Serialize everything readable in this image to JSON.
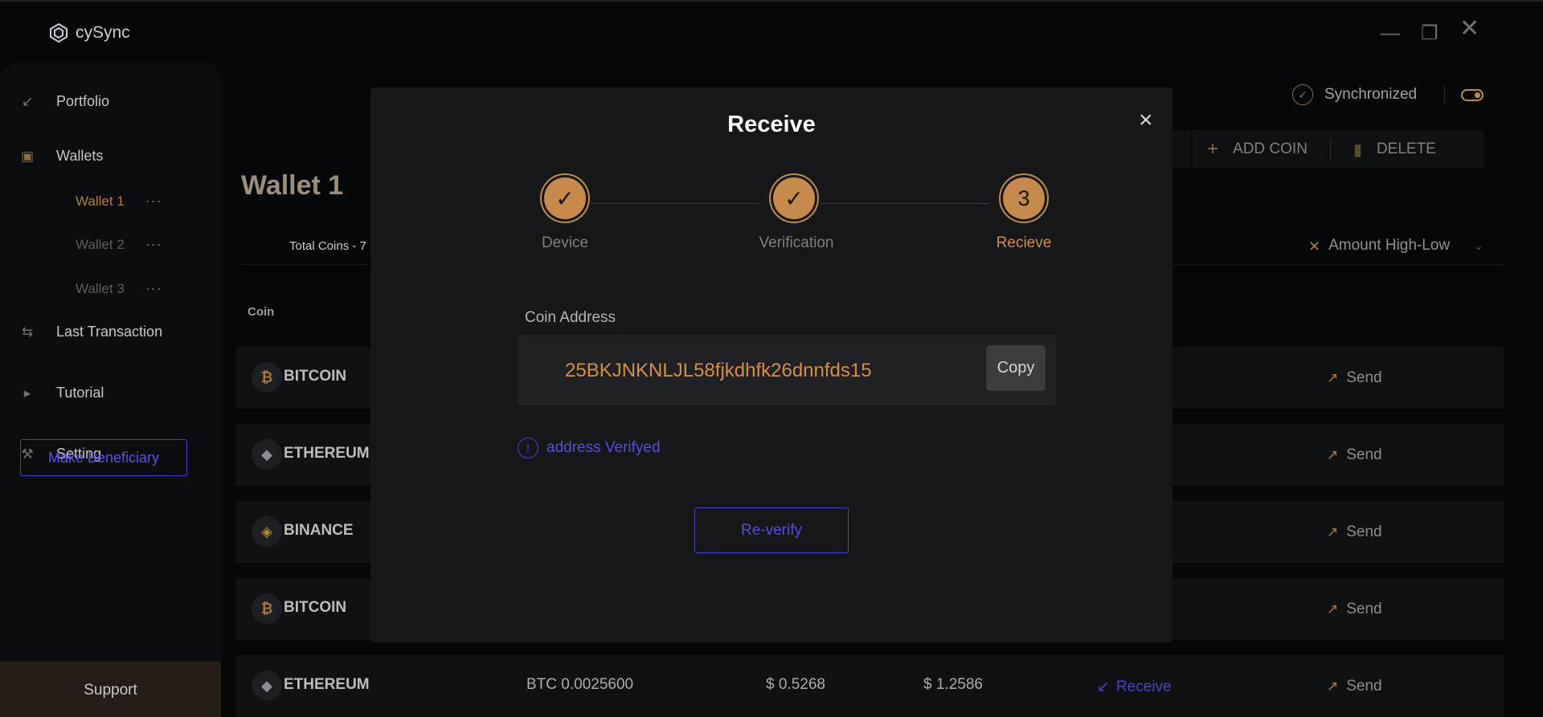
{
  "app": {
    "name": "cySync"
  },
  "sidebar": {
    "items": [
      {
        "label": "Portfolio",
        "icon": "portfolio-icon"
      },
      {
        "label": "Wallets",
        "icon": "wallet-icon"
      },
      {
        "label": "Last Transaction",
        "icon": "transfer-icon"
      },
      {
        "label": "Tutorial",
        "icon": "play-icon"
      },
      {
        "label": "Setting",
        "icon": "wrench-icon"
      }
    ],
    "wallets": [
      {
        "label": "Wallet 1",
        "active": true
      },
      {
        "label": "Wallet 2",
        "active": false
      },
      {
        "label": "Wallet 3",
        "active": false
      }
    ],
    "wallet_menu_glyph": "···",
    "beneficiary_button": "Make Beneficiary",
    "support": "Support"
  },
  "header": {
    "sync_status": "Synchronized",
    "add_coin": "ADD COIN",
    "delete": "DELETE"
  },
  "main": {
    "wallet_title": "Wallet 1",
    "total_coins": "Total Coins - 7",
    "sort_label": "Amount High-Low",
    "col_coin": "Coin",
    "rows": [
      {
        "coin": "BITCOIN",
        "symbol": "₿",
        "icon": "bitcoin-icon",
        "send": "Send"
      },
      {
        "coin": "ETHEREUM",
        "symbol": "◆",
        "icon": "ethereum-icon",
        "send": "Send"
      },
      {
        "coin": "BINANCE",
        "symbol": "◈",
        "icon": "binance-icon",
        "send": "Send"
      },
      {
        "coin": "BITCOIN",
        "symbol": "₿",
        "icon": "bitcoin-icon",
        "send": "Send"
      },
      {
        "coin": "ETHEREUM",
        "symbol": "◆",
        "icon": "ethereum-icon",
        "amount": "BTC 0.0025600",
        "price": "$ 0.5268",
        "value": "$ 1.2586",
        "receive": "Receive",
        "send": "Send"
      }
    ]
  },
  "modal": {
    "title": "Receive",
    "close_glyph": "×",
    "steps": [
      {
        "label": "Device",
        "state": "done",
        "glyph": "✓"
      },
      {
        "label": "Verification",
        "state": "done",
        "glyph": "✓"
      },
      {
        "label": "Recieve",
        "state": "current",
        "glyph": "3"
      }
    ],
    "address_label": "Coin Address",
    "address": "25BKJNKNLJL58fjkdhfk26dnnfds15",
    "copy_button": "Copy",
    "verified_text": "address Verifyed",
    "verified_glyph": "!",
    "reverify_button": "Re-verify"
  },
  "colors": {
    "accent": "#c68b4c",
    "link": "#554ee0"
  }
}
